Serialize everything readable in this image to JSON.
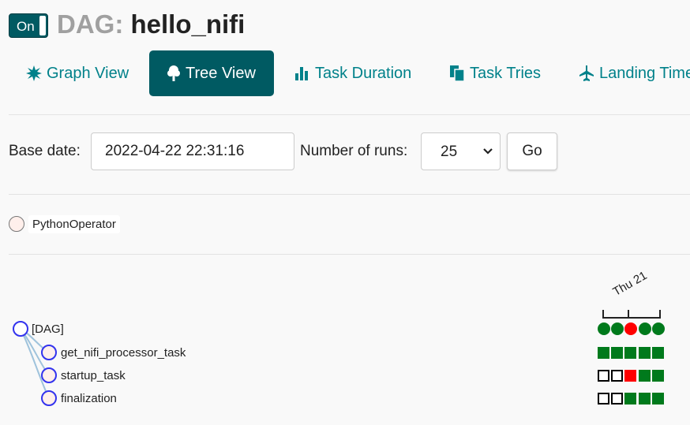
{
  "header": {
    "toggle_label": "On",
    "title_prefix": "DAG:",
    "dag_id": "hello_nifi"
  },
  "tabs": [
    {
      "label": "Graph View",
      "icon": "asterisk-icon",
      "active": false
    },
    {
      "label": "Tree View",
      "icon": "tree-icon",
      "active": true
    },
    {
      "label": "Task Duration",
      "icon": "bar-chart-icon",
      "active": false
    },
    {
      "label": "Task Tries",
      "icon": "duplicate-icon",
      "active": false
    },
    {
      "label": "Landing Times",
      "icon": "plane-icon",
      "active": false
    }
  ],
  "form": {
    "base_date_label": "Base date:",
    "base_date_value": "2022-04-22 22:31:16",
    "runs_label": "Number of runs:",
    "runs_value": "25",
    "go_label": "Go"
  },
  "legend": {
    "operator": "PythonOperator",
    "color": "#ffefeb"
  },
  "tree": {
    "date_label": "Thu 21",
    "root": "[DAG]",
    "tasks": [
      "get_nifi_processor_task",
      "startup_task",
      "finalization"
    ],
    "status_colors": {
      "success": "#007a1c",
      "failed": "#ff0000",
      "none": "#ffffff"
    },
    "dag_runs": [
      "success",
      "success",
      "failed",
      "success",
      "success"
    ],
    "task_instances": [
      [
        "success",
        "success",
        "success",
        "success",
        "success"
      ],
      [
        "none",
        "none",
        "failed",
        "success",
        "success"
      ],
      [
        "none",
        "none",
        "success",
        "success",
        "success"
      ]
    ]
  }
}
